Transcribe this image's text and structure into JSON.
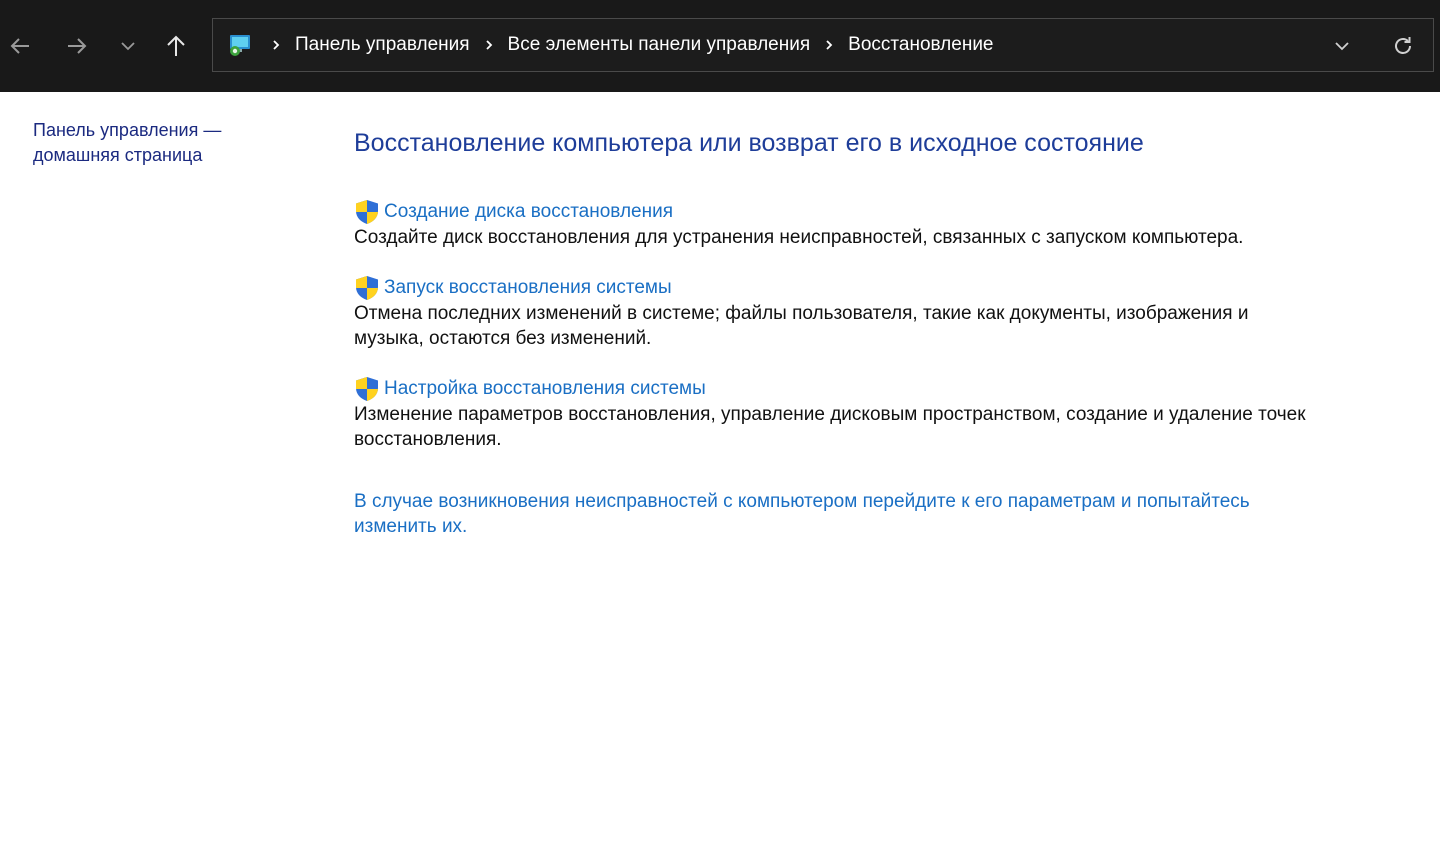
{
  "address_bar": {
    "breadcrumbs": [
      "Панель управления",
      "Все элементы панели управления",
      "Восстановление"
    ]
  },
  "icons": {
    "back": "arrow-left-icon",
    "forward": "arrow-right-icon",
    "recent": "chevron-down-icon",
    "up": "arrow-up-icon",
    "location": "control-panel-icon",
    "separator": "chevron-right-icon",
    "dropdown": "chevron-down-icon",
    "refresh": "refresh-icon",
    "task": "uac-shield-icon"
  },
  "left_pane": {
    "home_link_line1": "Панель управления —",
    "home_link_line2": "домашняя страница"
  },
  "main": {
    "title": "Восстановление компьютера или возврат его в исходное состояние",
    "tasks": [
      {
        "link": "Создание диска восстановления",
        "description": "Создайте диск восстановления для устранения неисправностей, связанных с запуском компьютера."
      },
      {
        "link": "Запуск восстановления системы",
        "description": "Отмена последних изменений в системе; файлы пользователя, такие как документы, изображения и музыка, остаются без изменений."
      },
      {
        "link": "Настройка восстановления системы",
        "description": "Изменение параметров восстановления, управление дисковым пространством, создание и удаление точек восстановления."
      }
    ],
    "footer_link": "В случае возникновения неисправностей с компьютером перейдите к его параметрам и попытайтесь изменить их."
  },
  "colors": {
    "toolbar_bg": "#191919",
    "title": "#1e3d99",
    "link": "#1a6fc4",
    "home_link": "#1b2a80",
    "text": "#111111"
  }
}
